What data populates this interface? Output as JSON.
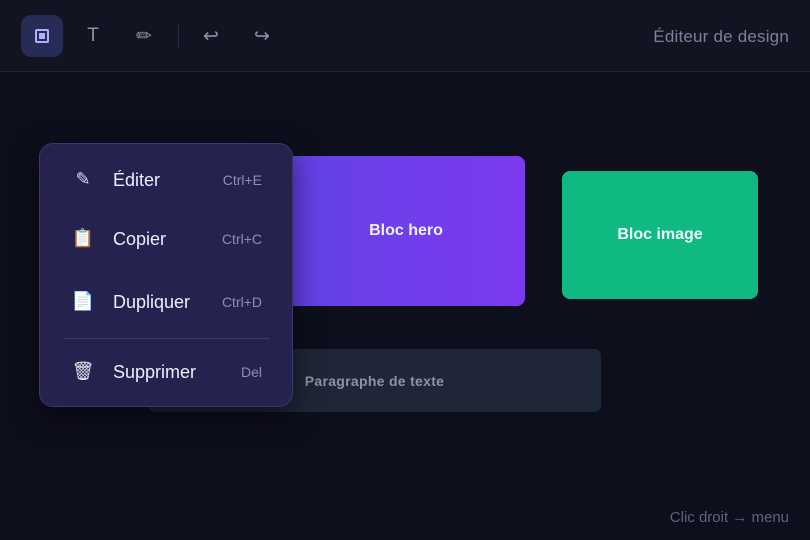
{
  "toolbar": {
    "tools": [
      {
        "name": "select-tool",
        "icon": "select-icon"
      },
      {
        "name": "text-tool",
        "icon": "text-icon",
        "glyph": "T"
      },
      {
        "name": "pen-tool",
        "icon": "pencil-icon",
        "glyph": "✏"
      },
      {
        "name": "undo-button",
        "icon": "undo-icon",
        "glyph": "↩"
      },
      {
        "name": "redo-button",
        "icon": "redo-icon",
        "glyph": "↪"
      }
    ],
    "title": "Éditeur de design"
  },
  "canvas": {
    "hero_label": "Bloc hero",
    "image_label": "Bloc image",
    "paragraph_label": "Paragraphe de texte"
  },
  "context_menu": {
    "items": [
      {
        "label": "Éditer",
        "shortcut": "Ctrl+E",
        "icon": "pencil-icon",
        "glyph": "✎"
      },
      {
        "label": "Copier",
        "shortcut": "Ctrl+C",
        "icon": "clipboard-icon",
        "glyph": "📋"
      },
      {
        "label": "Dupliquer",
        "shortcut": "Ctrl+D",
        "icon": "document-icon",
        "glyph": "📄"
      },
      {
        "label": "Supprimer",
        "shortcut": "Del",
        "icon": "trash-icon",
        "glyph": "🗑"
      }
    ]
  },
  "hint": "Clic droit → menu",
  "colors": {
    "background": "#0d0f1c",
    "menu": "#25224f",
    "hero_start": "#5f43e6",
    "hero_end": "#7c3aed",
    "image_block": "#10b981",
    "paragraph_block": "#1f2637"
  }
}
